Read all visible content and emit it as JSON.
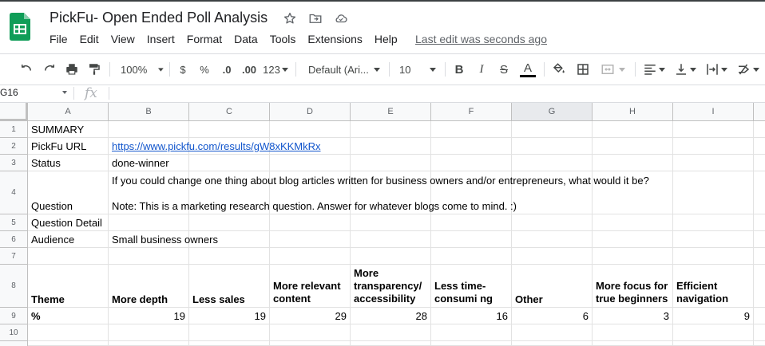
{
  "doc": {
    "title": "PickFu- Open Ended Poll Analysis",
    "menu": [
      "File",
      "Edit",
      "View",
      "Insert",
      "Format",
      "Data",
      "Tools",
      "Extensions",
      "Help"
    ],
    "last_edit": "Last edit was seconds ago"
  },
  "toolbar": {
    "zoom": "100%",
    "currency": "$",
    "percent": "%",
    "dec_decrease": ".0",
    "dec_increase": ".00",
    "more_formats": "123",
    "font": "Default (Ari...",
    "font_size": "10",
    "bold": "B",
    "italic": "I",
    "strike": "S",
    "text_color_letter": "A"
  },
  "formula_bar": {
    "name_box": "G16",
    "fx": "fx"
  },
  "colors": {
    "logo_green": "#0F9D58",
    "link": "#1155cc"
  },
  "columns": [
    "A",
    "B",
    "C",
    "D",
    "E",
    "F",
    "G",
    "H",
    "I"
  ],
  "rows": [
    "1",
    "2",
    "3",
    "4",
    "5",
    "6",
    "7",
    "8",
    "9",
    "10"
  ],
  "cells": {
    "a1": "SUMMARY",
    "a2": "PickFu URL",
    "b2": "https://www.pickfu.com/results/gW8xKKMkRx",
    "a3": "Status",
    "b3": "done-winner",
    "a4": "Question",
    "b4_line1": "If you could change one thing about blog articles written for business owners and/or entrepreneurs, what would it be?",
    "b4_line2": "Note: This is a marketing research question. Answer for whatever blogs come to mind. :)",
    "a5": "Question Detail",
    "a6": "Audience",
    "b6": "Small business owners",
    "a8": "Theme",
    "b8": "More depth",
    "c8": "Less sales",
    "d8": "More relevant content",
    "e8": "More transparency/ accessibility",
    "f8": "Less time-consumi ng",
    "g8": "Other",
    "h8": "More focus for true beginners",
    "i8": "Efficient navigation",
    "a9": "%",
    "b9": "19",
    "c9": "19",
    "d9": "29",
    "e9": "28",
    "f9": "16",
    "g9": "6",
    "h9": "3",
    "i9": "9"
  }
}
